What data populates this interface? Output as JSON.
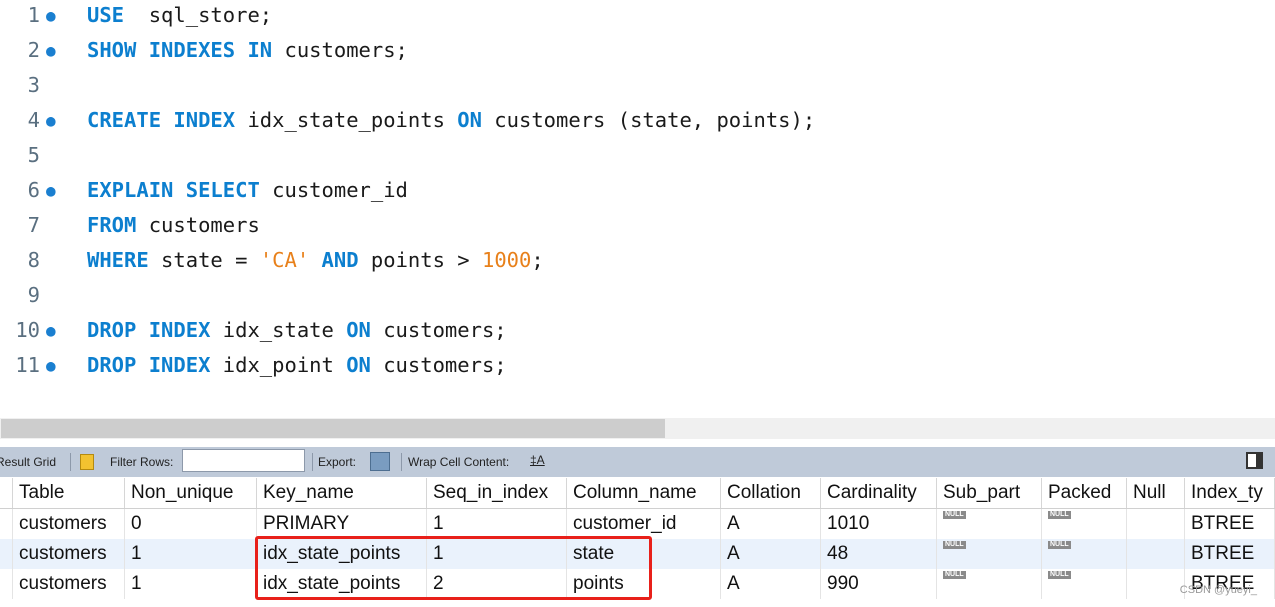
{
  "editor": {
    "lines": [
      {
        "num": "1",
        "dot": true,
        "tokens": [
          [
            "kw",
            "USE"
          ],
          [
            "",
            "  sql_store;"
          ]
        ]
      },
      {
        "num": "2",
        "dot": true,
        "tokens": [
          [
            "kw",
            "SHOW INDEXES IN"
          ],
          [
            "",
            " customers;"
          ]
        ]
      },
      {
        "num": "3",
        "dot": false,
        "tokens": []
      },
      {
        "num": "4",
        "dot": true,
        "tokens": [
          [
            "kw",
            "CREATE INDEX"
          ],
          [
            "",
            " idx_state_points "
          ],
          [
            "kw",
            "ON"
          ],
          [
            "",
            " customers (state, points);"
          ]
        ]
      },
      {
        "num": "5",
        "dot": false,
        "tokens": []
      },
      {
        "num": "6",
        "dot": true,
        "tokens": [
          [
            "kw",
            "EXPLAIN SELECT"
          ],
          [
            "",
            " customer_id"
          ]
        ]
      },
      {
        "num": "7",
        "dot": false,
        "tokens": [
          [
            "kw",
            "FROM"
          ],
          [
            "",
            " customers"
          ]
        ]
      },
      {
        "num": "8",
        "dot": false,
        "tokens": [
          [
            "kw",
            "WHERE"
          ],
          [
            "",
            " state = "
          ],
          [
            "str",
            "'CA'"
          ],
          [
            "",
            " "
          ],
          [
            "kw",
            "AND"
          ],
          [
            "",
            " points > "
          ],
          [
            "num",
            "1000"
          ],
          [
            "",
            ";"
          ]
        ]
      },
      {
        "num": "9",
        "dot": false,
        "tokens": []
      },
      {
        "num": "10",
        "dot": true,
        "tokens": [
          [
            "kw",
            "DROP INDEX"
          ],
          [
            "",
            " idx_state "
          ],
          [
            "kw",
            "ON"
          ],
          [
            "",
            " customers;"
          ]
        ]
      },
      {
        "num": "11",
        "dot": true,
        "tokens": [
          [
            "kw",
            "DROP INDEX"
          ],
          [
            "",
            " idx_point "
          ],
          [
            "kw",
            "ON"
          ],
          [
            "",
            " customers;"
          ]
        ]
      }
    ]
  },
  "toolbar": {
    "result_grid": "Result Grid",
    "filter_rows": "Filter Rows:",
    "filter_value": "",
    "export": "Export:",
    "wrap": "Wrap Cell Content:"
  },
  "grid": {
    "columns": [
      "Table",
      "Non_unique",
      "Key_name",
      "Seq_in_index",
      "Column_name",
      "Collation",
      "Cardinality",
      "Sub_part",
      "Packed",
      "Null",
      "Index_ty"
    ],
    "rows": [
      [
        "customers",
        "0",
        "PRIMARY",
        "1",
        "customer_id",
        "A",
        "1010",
        "NULL",
        "NULL",
        "",
        "BTREE"
      ],
      [
        "customers",
        "1",
        "idx_state_points",
        "1",
        "state",
        "A",
        "48",
        "NULL",
        "NULL",
        "",
        "BTREE"
      ],
      [
        "customers",
        "1",
        "idx_state_points",
        "2",
        "points",
        "A",
        "990",
        "NULL",
        "NULL",
        "",
        "BTREE"
      ]
    ],
    "highlight_color": "#e8201a"
  },
  "watermark": "CSDN @yueyi_"
}
